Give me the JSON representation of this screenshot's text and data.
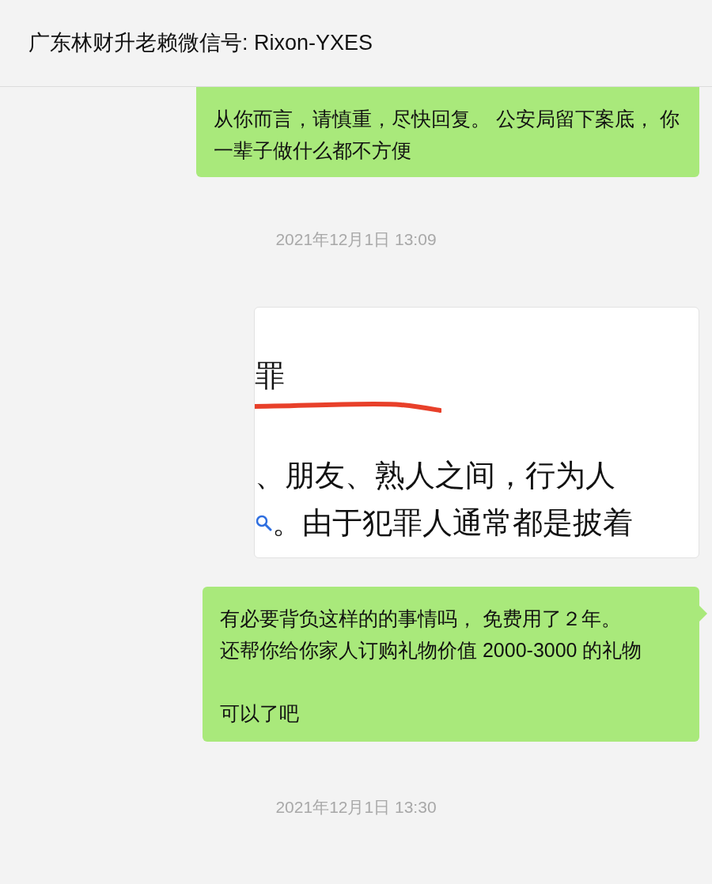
{
  "header": {
    "title": "广东林财升老赖微信号: Rixon-YXES"
  },
  "messages": [
    {
      "kind": "text",
      "cut_top": true,
      "paragraphs": [
        [
          "从你而言，请慎重，尽快回复。 公安局留下案底， 你一辈子做什么都不方便"
        ]
      ]
    },
    {
      "kind": "time",
      "text": "2021年12月1日 13:09"
    },
    {
      "kind": "image",
      "lines": [
        "罪",
        "、朋友、熟人之间，行为人",
        "。由于犯罪人通常都是披着"
      ]
    },
    {
      "kind": "text",
      "cut_top": false,
      "paragraphs": [
        [
          "有必要背负这样的的事情吗， 免费用了２年。",
          "还帮你给你家人订购礼物价值 2000-3000 的礼物"
        ],
        [
          "可以了吧"
        ]
      ]
    },
    {
      "kind": "time",
      "text": "2021年12月1日 13:30"
    }
  ]
}
